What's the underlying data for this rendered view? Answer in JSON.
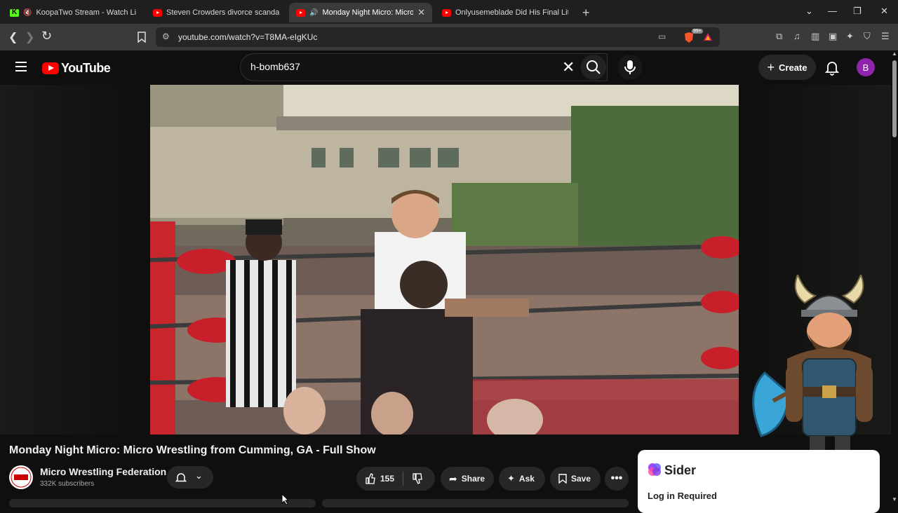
{
  "browser": {
    "tabs": [
      {
        "title": "KoopaTwo Stream - Watch Live o",
        "favicon": "kick-icon",
        "active": false
      },
      {
        "title": "Steven Crowders divorce scandal | RE",
        "favicon": "youtube-icon",
        "active": false
      },
      {
        "title": "Monday Night Micro: Micro V",
        "favicon": "youtube-icon",
        "active": true
      },
      {
        "title": "Onlyusemeblade Did His Final Litty St",
        "favicon": "youtube-icon",
        "active": false
      }
    ],
    "url": "youtube.com/watch?v=T8MA-eIgKUc",
    "brave_badge": "99+"
  },
  "youtube": {
    "logo_text": "YouTube",
    "search_value": "h-bomb637",
    "create_label": "Create",
    "avatar_letter": "B"
  },
  "video": {
    "title": "Monday Night Micro: Micro Wrestling from Cumming, GA - Full Show",
    "channel_name": "Micro Wrestling Federation",
    "subscribers": "332K subscribers",
    "likes": "155",
    "share_label": "Share",
    "ask_label": "Ask",
    "save_label": "Save"
  },
  "sider": {
    "name": "Sider",
    "login_text": "Log in Required"
  },
  "colors": {
    "youtube_red": "#ff0000",
    "avatar_purple": "#8e24aa",
    "background": "#0f0f0f"
  }
}
